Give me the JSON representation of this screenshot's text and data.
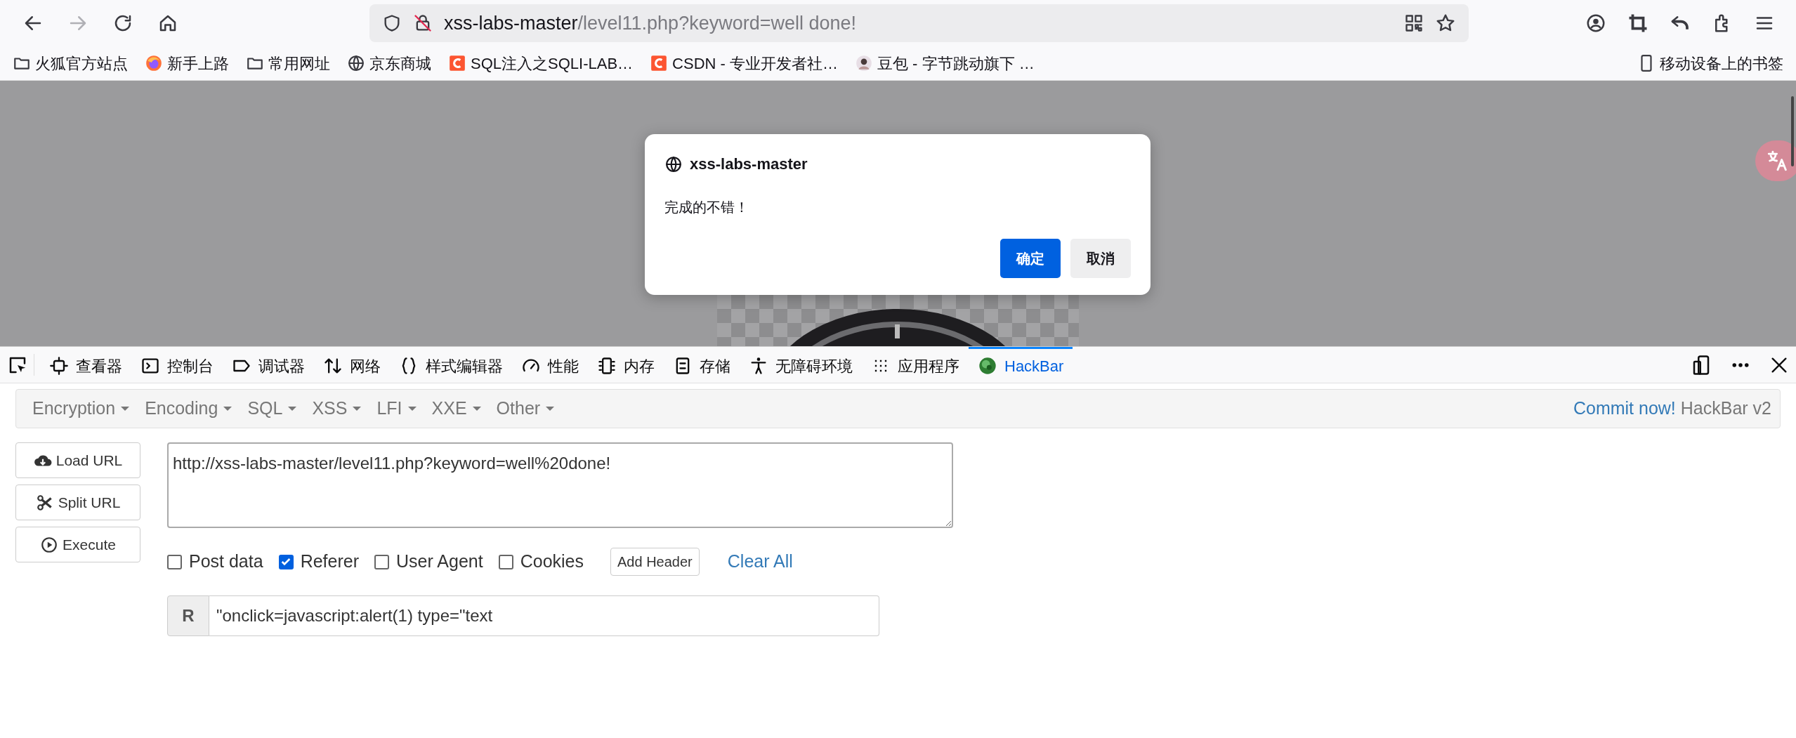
{
  "nav": [
    {
      "kind": "back",
      "disabled": false
    },
    {
      "kind": "forward",
      "disabled": true
    },
    {
      "kind": "reload",
      "disabled": false
    },
    {
      "kind": "home",
      "disabled": false
    }
  ],
  "address_bar": {
    "host": "xss-labs-master",
    "path": "/level11.php?keyword=well done!"
  },
  "bookmarks": [
    {
      "kind": "folder",
      "label": "火狐官方站点"
    },
    {
      "kind": "firefox",
      "label": "新手上路"
    },
    {
      "kind": "folder",
      "label": "常用网址"
    },
    {
      "kind": "globe",
      "label": "京东商城"
    },
    {
      "kind": "csdn",
      "label": "SQL注入之SQLI-LAB…"
    },
    {
      "kind": "csdn",
      "label": "CSDN - 专业开发者社…"
    },
    {
      "kind": "avatar",
      "label": "豆包 - 字节跳动旗下 …"
    }
  ],
  "mobile_bookmarks": "移动设备上的书签",
  "dialog": {
    "title": "xss-labs-master",
    "message": "完成的不错！",
    "buttons": [
      {
        "label": "确定",
        "kind": "primary"
      },
      {
        "label": "取消",
        "kind": "secondary"
      }
    ]
  },
  "devtools": {
    "tabs": [
      {
        "kind": "inspector",
        "label": "查看器",
        "selected": false
      },
      {
        "kind": "console",
        "label": "控制台",
        "selected": false
      },
      {
        "kind": "debugger",
        "label": "调试器",
        "selected": false
      },
      {
        "kind": "network",
        "label": "网络",
        "selected": false
      },
      {
        "kind": "style",
        "label": "样式编辑器",
        "selected": false
      },
      {
        "kind": "performance",
        "label": "性能",
        "selected": false
      },
      {
        "kind": "memory",
        "label": "内存",
        "selected": false
      },
      {
        "kind": "storage",
        "label": "存储",
        "selected": false
      },
      {
        "kind": "accessibility",
        "label": "无障碍环境",
        "selected": false
      },
      {
        "kind": "application",
        "label": "应用程序",
        "selected": false
      },
      {
        "kind": "hackbar",
        "label": "HackBar",
        "selected": true
      }
    ]
  },
  "hackbar": {
    "menus": [
      "Encryption",
      "Encoding",
      "SQL",
      "XSS",
      "LFI",
      "XXE",
      "Other"
    ],
    "commit_link": "Commit now!",
    "version": "HackBar v2",
    "actions": [
      {
        "kind": "load",
        "label": "Load URL"
      },
      {
        "kind": "split",
        "label": "Split URL"
      },
      {
        "kind": "execute",
        "label": "Execute"
      }
    ],
    "url": "http://xss-labs-master/level11.php?keyword=well%20done!",
    "options": [
      {
        "label": "Post data",
        "checked": false
      },
      {
        "label": "Referer",
        "checked": true
      },
      {
        "label": "User Agent",
        "checked": false
      },
      {
        "label": "Cookies",
        "checked": false
      }
    ],
    "add_header": "Add Header",
    "clear_all": "Clear All",
    "headers": [
      {
        "name": "R",
        "value": "\"onclick=javascript:alert(1) type=\"text"
      }
    ]
  }
}
